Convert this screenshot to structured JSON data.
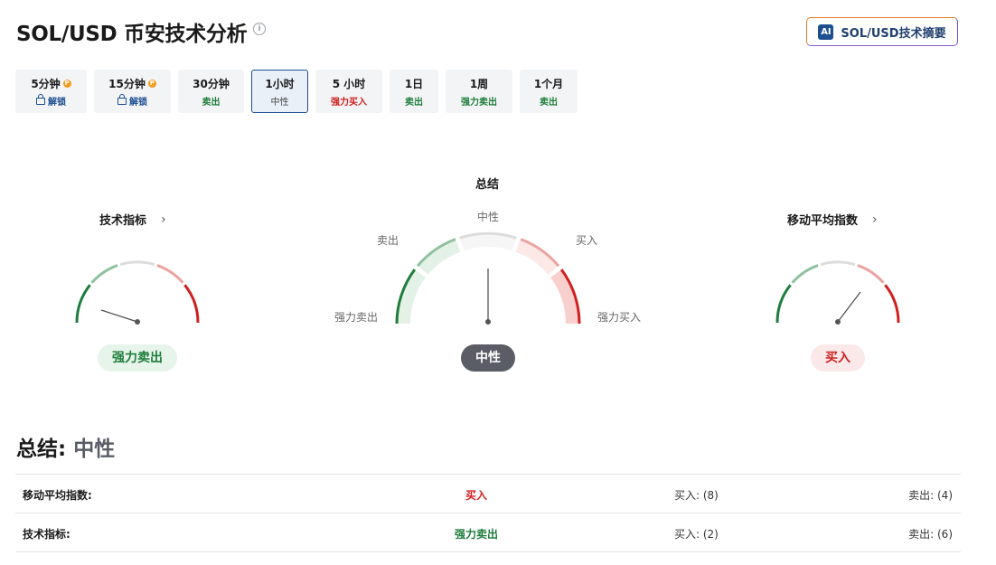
{
  "page": {
    "title": "SOL/USD 币安技术分析",
    "ai_button": "SOL/USD技术摘要",
    "ai_icon_text": "AI"
  },
  "tabs": [
    {
      "label": "5分钟",
      "sub": "解锁",
      "locked": true
    },
    {
      "label": "15分钟",
      "sub": "解锁",
      "locked": true
    },
    {
      "label": "30分钟",
      "sub": "卖出"
    },
    {
      "label": "1小时",
      "sub": "中性",
      "active": true
    },
    {
      "label": "5 小时",
      "sub": "强力买入"
    },
    {
      "label": "1日",
      "sub": "卖出"
    },
    {
      "label": "1周",
      "sub": "强力卖出"
    },
    {
      "label": "1个月",
      "sub": "卖出"
    }
  ],
  "gauges": {
    "technical": {
      "title": "技术指标",
      "result": "强力卖出"
    },
    "summary": {
      "title": "总结",
      "result": "中性",
      "labels": {
        "neutral": "中性",
        "sell": "卖出",
        "buy": "买入",
        "strong_sell": "强力卖出",
        "strong_buy": "强力买入"
      }
    },
    "moving_avg": {
      "title": "移动平均指数",
      "result": "买入"
    }
  },
  "summary": {
    "label": "总结:",
    "value": "中性"
  },
  "table": [
    {
      "name": "移动平均指数:",
      "signal": "买入",
      "buy": "买入: (8)",
      "sell": "卖出: (4)"
    },
    {
      "name": "技术指标:",
      "signal": "强力卖出",
      "buy": "买入: (2)",
      "sell": "卖出: (6)"
    }
  ],
  "colors": {
    "strong_sell": "#1e7d3c",
    "sell": "#8fc19f",
    "neutral": "#dcdcdc",
    "buy": "#eaa4a0",
    "strong_buy": "#d12020",
    "brand": "#1d4f91"
  }
}
